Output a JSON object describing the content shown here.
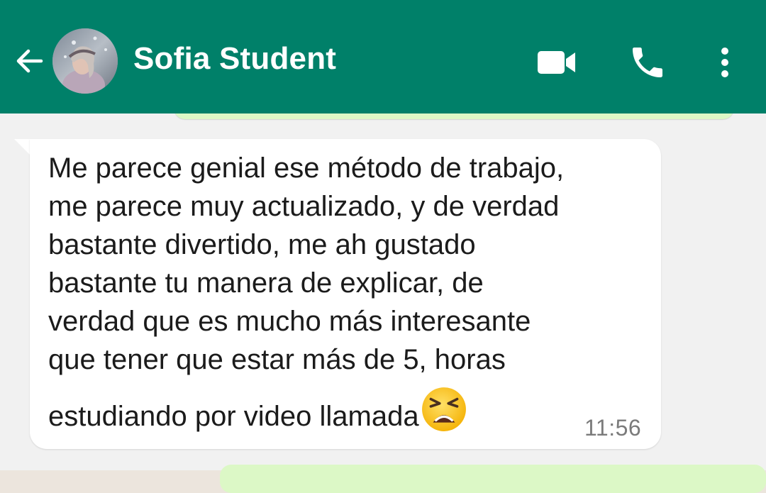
{
  "header": {
    "contact_name": "Sofia Student",
    "back_icon": "arrow-left-icon",
    "video_icon": "videocam-icon",
    "call_icon": "phone-icon",
    "menu_icon": "more-vertical-icon",
    "background_color": "#008069"
  },
  "message": {
    "lines": [
      "Me parece genial ese método de trabajo,",
      "me parece muy actualizado, y de verdad",
      "bastante divertido, me ah gustado",
      "bastante tu manera de explicar, de",
      "verdad que es mucho más interesante",
      "que tener que estar más de 5, horas",
      "estudiando por video llamada"
    ],
    "emoji": "tired-face-emoji",
    "time": "11:56",
    "direction": "incoming"
  },
  "colors": {
    "outgoing_bubble": "#DCF8C6",
    "incoming_bubble": "#FFFFFF",
    "chat_background": "#F1F1F1"
  }
}
